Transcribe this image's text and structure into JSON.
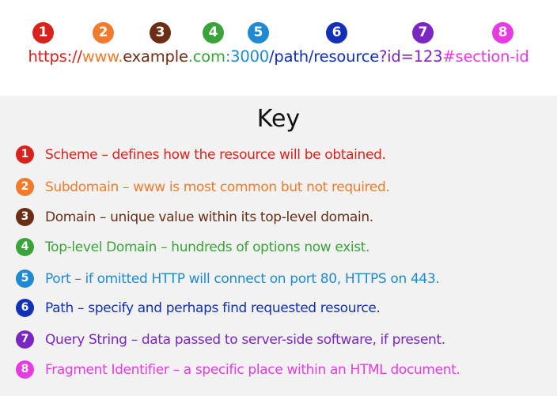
{
  "colors": {
    "c1": "#d9221c",
    "c2": "#f07a2e",
    "c3": "#6b2d14",
    "c4": "#3aa33a",
    "c5": "#1f8ad1",
    "c6": "#1230b8",
    "c7": "#7a26c2",
    "c8": "#e63be0"
  },
  "badges": [
    "1",
    "2",
    "3",
    "4",
    "5",
    "6",
    "7",
    "8"
  ],
  "url_parts": {
    "scheme": "https://",
    "subdomain": "www.",
    "domain": "example",
    "tld": ".com",
    "port": ":3000",
    "path": "/path/resource",
    "query": "?id=123",
    "fragment": "#section-id"
  },
  "key": {
    "title": "Key",
    "items": [
      {
        "num": "1",
        "text": "Scheme – defines how the resource will be obtained."
      },
      {
        "num": "2",
        "text": "Subdomain – www is most common but not required."
      },
      {
        "num": "3",
        "text": "Domain – unique value within its top-level domain."
      },
      {
        "num": "4",
        "text": "Top-level Domain – hundreds of options now exist."
      },
      {
        "num": "5",
        "text": "Port – if omitted HTTP will connect on port 80, HTTPS on 443."
      },
      {
        "num": "6",
        "text": "Path – specify and perhaps find requested resource."
      },
      {
        "num": "7",
        "text": "Query String – data passed to server-side software, if present."
      },
      {
        "num": "8",
        "text": "Fragment Identifier – a specific place within an HTML document."
      }
    ]
  }
}
